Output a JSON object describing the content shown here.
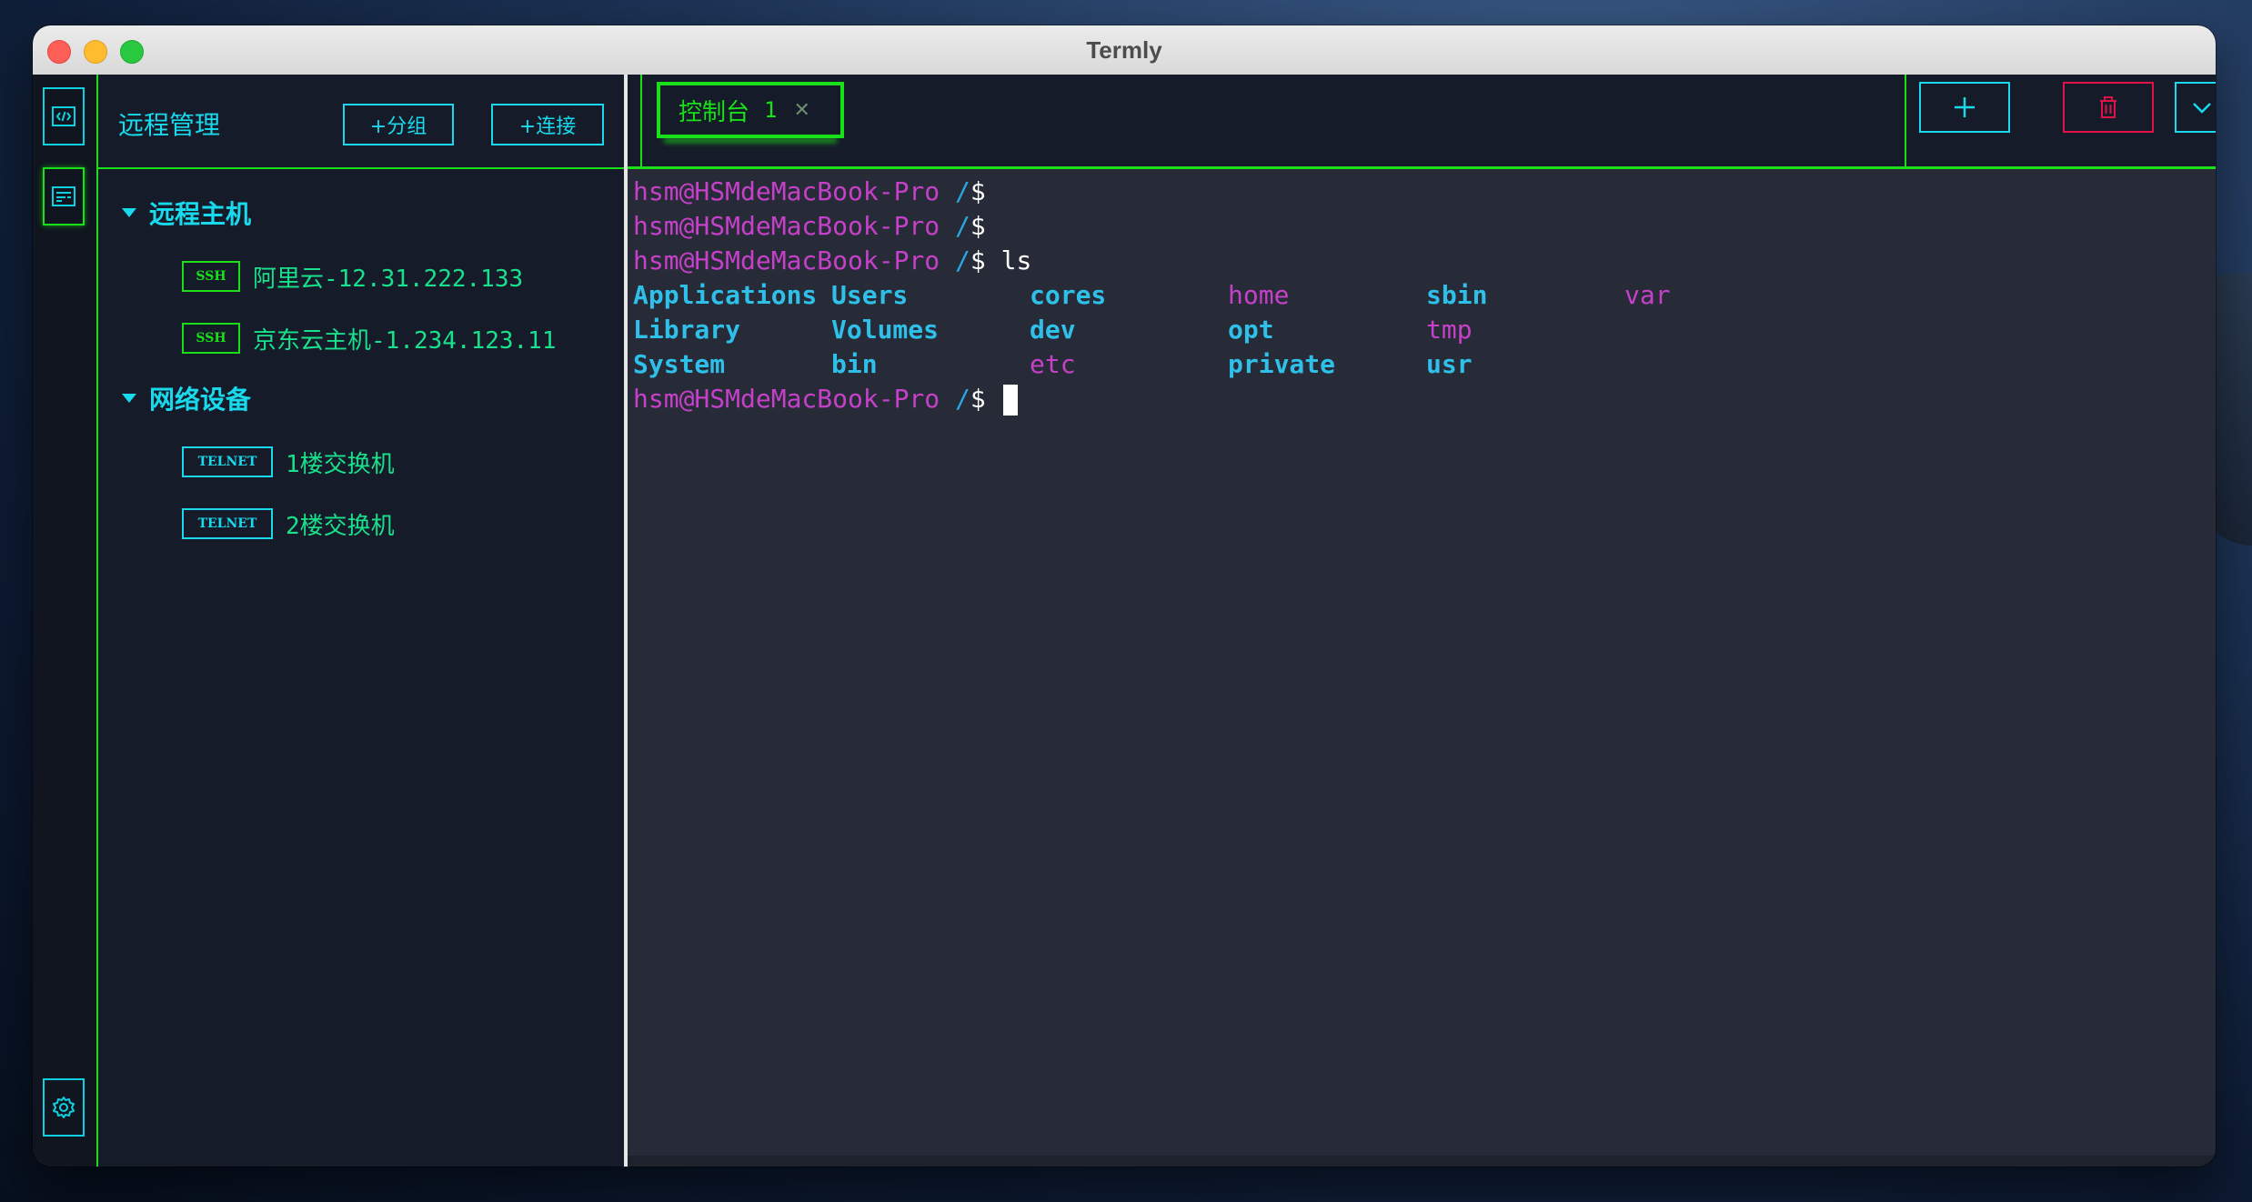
{
  "window": {
    "title": "Termly"
  },
  "sidebar": {
    "title": "远程管理",
    "add_group_label": "+分组",
    "add_connection_label": "+连接",
    "groups": [
      {
        "name": "远程主机",
        "hosts": [
          {
            "protocol": "SSH",
            "name": "阿里云-12.31.222.133"
          },
          {
            "protocol": "SSH",
            "name": "京东云主机-1.234.123.11"
          }
        ]
      },
      {
        "name": "网络设备",
        "hosts": [
          {
            "protocol": "TELNET",
            "name": "1楼交换机"
          },
          {
            "protocol": "TELNET",
            "name": "2楼交换机"
          }
        ]
      }
    ]
  },
  "activity_bar": {
    "icons": [
      "code-icon",
      "connections-icon",
      "settings-icon"
    ]
  },
  "tabs": [
    {
      "label": "控制台",
      "number": "1"
    }
  ],
  "toolbar": {
    "icons": [
      "plus-icon",
      "trash-icon",
      "chevron-down-icon"
    ]
  },
  "terminal": {
    "prompt_user": "hsm@HSMdeMacBook-Pro",
    "prompt_path": "/",
    "prompt_symbol": "$",
    "lines": [
      {
        "command": ""
      },
      {
        "command": ""
      },
      {
        "command": " ls"
      }
    ],
    "ls_output": [
      [
        "Applications",
        "Users",
        "cores",
        "home",
        "sbin",
        "var"
      ],
      [
        "Library",
        "Volumes",
        "dev",
        "opt",
        "tmp",
        ""
      ],
      [
        "System",
        "bin",
        "etc",
        "private",
        "usr",
        ""
      ]
    ],
    "ls_output_kinds": [
      [
        "dir",
        "dir",
        "dir",
        "link",
        "dir",
        "link"
      ],
      [
        "dir",
        "dir",
        "dir",
        "dir",
        "link",
        ""
      ],
      [
        "dir",
        "dir",
        "link",
        "dir",
        "dir",
        ""
      ]
    ]
  },
  "colors": {
    "accent_green": "#19e019",
    "accent_cyan": "#19d9ec",
    "danger_red": "#e3114a",
    "prompt_magenta": "#c640c9",
    "terminal_bg": "#272b38",
    "sidebar_bg": "#151b29"
  }
}
